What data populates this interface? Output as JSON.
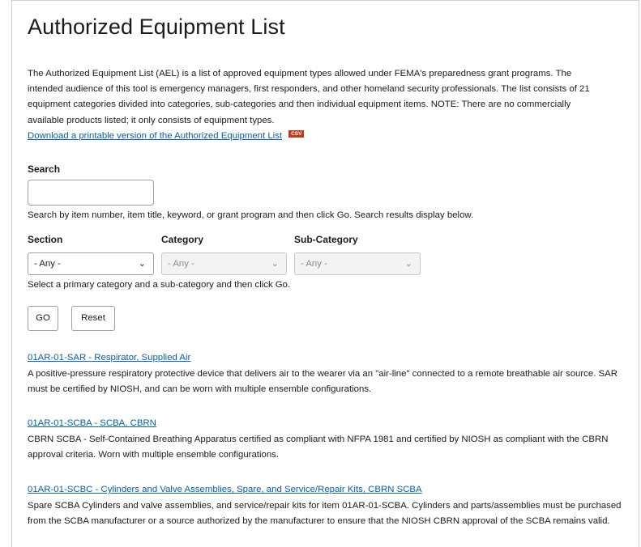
{
  "page_title": "Authorized Equipment List",
  "intro": {
    "text": "The Authorized Equipment List (AEL) is a list of approved equipment types allowed under FEMA's preparedness grant programs. The intended audience of this tool is emergency managers, first responders, and other homeland security professionals. The list consists of 21 equipment categories divided into categories, sub-categories and then individual equipment items. NOTE: There are no commercially available products listed; it only consists of equipment types.",
    "download_link": "Download a printable version of the Authorized Equipment List",
    "csv_badge": "CSV"
  },
  "search": {
    "label": "Search",
    "value": "",
    "help": "Search by item number, item title, keyword, or grant program and then click Go. Search results display below."
  },
  "filters": {
    "section_label": "Section",
    "category_label": "Category",
    "subcategory_label": "Sub-Category",
    "section_value": "- Any -",
    "category_value": "- Any -",
    "subcategory_value": "- Any -",
    "help": "Select a primary category and a sub-category and then click Go."
  },
  "buttons": {
    "go": "GO",
    "reset": "Reset"
  },
  "results": [
    {
      "title": "01AR-01-SAR - Respirator, Supplied Air",
      "description": "A positive-pressure respiratory protective device that delivers air to the wearer via an \"air-line\" connected to a remote breathable air source. SAR must be certified by NIOSH, and can be worn with multiple ensemble configurations."
    },
    {
      "title": "01AR-01-SCBA - SCBA, CBRN",
      "description": "CBRN SCBA - Self-Contained Breathing Apparatus certified as compliant with NFPA 1981 and certified by NIOSH as compliant with the CBRN approval criteria. Worn with multiple ensemble configurations."
    },
    {
      "title": "01AR-01-SCBC - Cylinders and Valve Assemblies, Spare, and Service/Repair Kits, CBRN SCBA",
      "description": "Spare SCBA Cylinders and valve assemblies, and service/repair kits for item 01AR-01-SCBA. Cylinders and parts/assemblies must be purchased from the SCBA manufacturer or a source authorized by the manufacturer to ensure that the NIOSH CBRN approval of the SCBA remains valid."
    }
  ],
  "icons": {
    "dropdown": "chevron-down-icon"
  },
  "colors": {
    "link": "#0b5fa5",
    "csv_badge": "#c23a1a"
  }
}
